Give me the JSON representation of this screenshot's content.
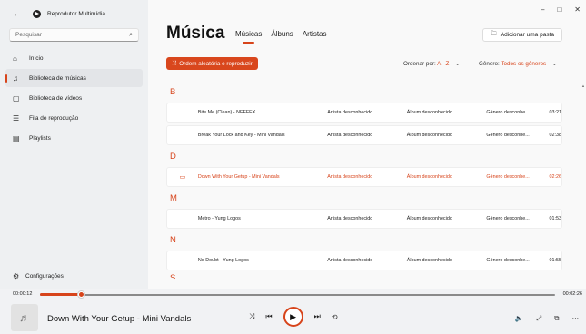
{
  "app": {
    "title": "Reprodutor Multimídia"
  },
  "window_controls": {
    "minimize": "–",
    "maximize": "□",
    "close": "✕"
  },
  "sidebar": {
    "search_placeholder": "Pesquisar",
    "items": [
      {
        "label": "Início",
        "icon": "home-icon",
        "glyph": "⌂"
      },
      {
        "label": "Biblioteca de músicas",
        "icon": "music-note-icon",
        "glyph": "♫"
      },
      {
        "label": "Biblioteca de vídeos",
        "icon": "video-icon",
        "glyph": "▢"
      },
      {
        "label": "Fila de reprodução",
        "icon": "queue-icon",
        "glyph": "☰"
      },
      {
        "label": "Playlists",
        "icon": "playlist-icon",
        "glyph": "▤"
      }
    ],
    "settings_label": "Configurações"
  },
  "main": {
    "title": "Música",
    "tabs": [
      "Músicas",
      "Álbuns",
      "Artistas"
    ],
    "add_folder_label": "Adicionar uma pasta",
    "shuffle_label": "Ordem aleatória e reproduzir",
    "sort_label": "Ordenar por:",
    "sort_value": "A - Z",
    "genre_label": "Gênero:",
    "genre_value": "Todos os gêneros",
    "letters": [
      "B",
      "D",
      "M",
      "N",
      "S"
    ],
    "songs": [
      {
        "title": "Bite Me (Clean) - NEFFEX",
        "artist": "Artista desconhecido",
        "album": "Álbum desconhecido",
        "genre": "Gênero desconhe...",
        "duration": "03:21"
      },
      {
        "title": "Break Your Lock and Key - Mini Vandals",
        "artist": "Artista desconhecido",
        "album": "Álbum desconhecido",
        "genre": "Gênero desconhe...",
        "duration": "02:38"
      },
      {
        "title": "Down With Your Getup - Mini Vandals",
        "artist": "Artista desconhecido",
        "album": "Álbum desconhecido",
        "genre": "Gênero desconhe...",
        "duration": "02:26"
      },
      {
        "title": "Metro - Yung Logos",
        "artist": "Artista desconhecido",
        "album": "Álbum desconhecido",
        "genre": "Gênero desconhe...",
        "duration": "01:53"
      },
      {
        "title": "No Doubt - Yung Logos",
        "artist": "Artista desconhecido",
        "album": "Álbum desconhecido",
        "genre": "Gênero desconhe...",
        "duration": "01:55"
      }
    ]
  },
  "player": {
    "elapsed": "00:00:12",
    "total": "00:02:26",
    "progress_fraction": 0.08,
    "now_playing": "Down With Your Getup - Mini Vandals"
  },
  "colors": {
    "accent": "#d7441b"
  }
}
